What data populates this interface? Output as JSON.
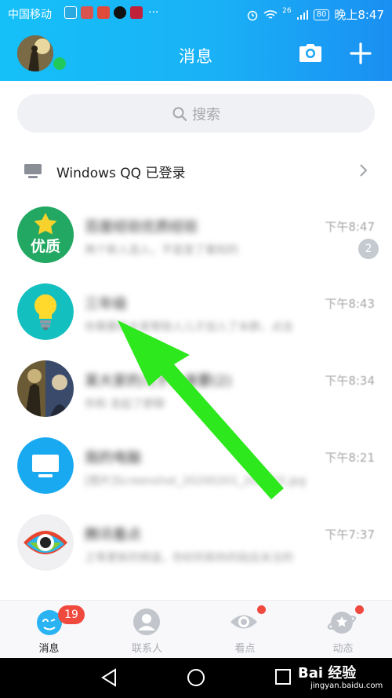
{
  "status_bar": {
    "carrier": "中国移动",
    "more": "···",
    "signal_label": "26",
    "battery": "80",
    "time": "晚上8:47"
  },
  "header": {
    "title": "消息"
  },
  "search": {
    "placeholder": "搜索"
  },
  "pc_login": {
    "label": "Windows QQ 已登录"
  },
  "conversations": [
    {
      "name": "百度经验优质经验",
      "preview": "两个新人选入，不是是了看知的",
      "time": "下午8:47",
      "badge": "2",
      "avatar_icon": "quality-star-icon",
      "avatar_text": "优质"
    },
    {
      "name": "三年级",
      "preview": "你需要的大家帮助人儿子加入了本群，点击",
      "time": "下午8:43",
      "badge": "",
      "avatar_icon": "lightbulb-icon",
      "avatar_text": ""
    },
    {
      "name": "某大家的儿子，谁要(2)",
      "preview": "你和 发起了群聊",
      "time": "下午8:34",
      "badge": "",
      "avatar_icon": "photo-avatar",
      "avatar_text": ""
    },
    {
      "name": "我的电脑",
      "preview": "[图片]Screenshot_20200201_205715.jpg",
      "time": "下午8:21",
      "badge": "",
      "avatar_icon": "monitor-icon",
      "avatar_text": ""
    },
    {
      "name": "腾讯看点",
      "preview": "之等更新的频道，你好的和你的段后关注的",
      "time": "下午7:37",
      "badge": "",
      "avatar_icon": "eye-logo-icon",
      "avatar_text": ""
    }
  ],
  "tabs": [
    {
      "label": "消息",
      "badge": "19"
    },
    {
      "label": "联系人"
    },
    {
      "label": "看点"
    },
    {
      "label": "动态"
    }
  ],
  "watermark": {
    "brand": "Bai 经验",
    "url": "jingyan.baidu.com"
  },
  "colors": {
    "header_start": "#15c0f8",
    "header_end": "#1a8ff2",
    "online": "#21c95b",
    "badge_red": "#f0493e",
    "arrow_green": "#2ee81e"
  }
}
